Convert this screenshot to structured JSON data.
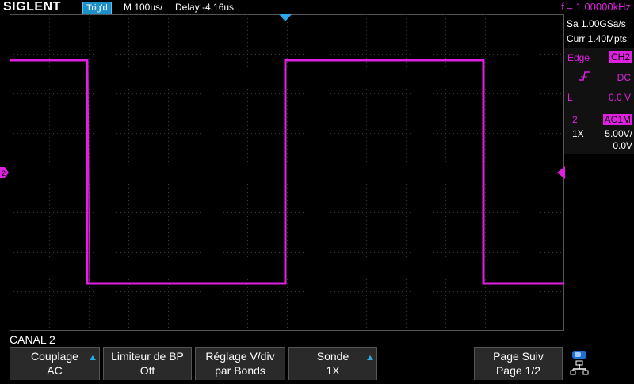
{
  "header": {
    "brand": "SIGLENT",
    "trigger_status": "Trig'd",
    "timebase": "M 100us/",
    "delay": "Delay:-4.16us",
    "frequency": "f = 1.00000kHz"
  },
  "acquisition": {
    "sample_rate": "Sa 1.00GSa/s",
    "memory_depth": "Curr 1.40Mpts"
  },
  "trigger": {
    "type": "Edge",
    "source": "CH2",
    "slope_icon": "rising-edge-icon",
    "coupling": "DC",
    "level_label": "L",
    "level": "0.0 V"
  },
  "channel": {
    "number": "2",
    "coupling": "AC1M",
    "probe": "1X",
    "scale": "5.00V/",
    "offset": "0.0V"
  },
  "menu": {
    "title": "CANAL 2",
    "softkeys": [
      {
        "line1": "Couplage",
        "line2": "AC",
        "has_arrow": true
      },
      {
        "line1": "Limiteur de BP",
        "line2": "Off",
        "has_arrow": false
      },
      {
        "line1": "Réglage V/div",
        "line2": "par Bonds",
        "has_arrow": false
      },
      {
        "line1": "Sonde",
        "line2": "1X",
        "has_arrow": true
      },
      {
        "line1": "Page Suiv",
        "line2": "Page 1/2",
        "has_arrow": false
      }
    ]
  },
  "colors": {
    "trace": "#e020e0",
    "accent": "#1e90c8",
    "grid": "#3a3a3a"
  }
}
